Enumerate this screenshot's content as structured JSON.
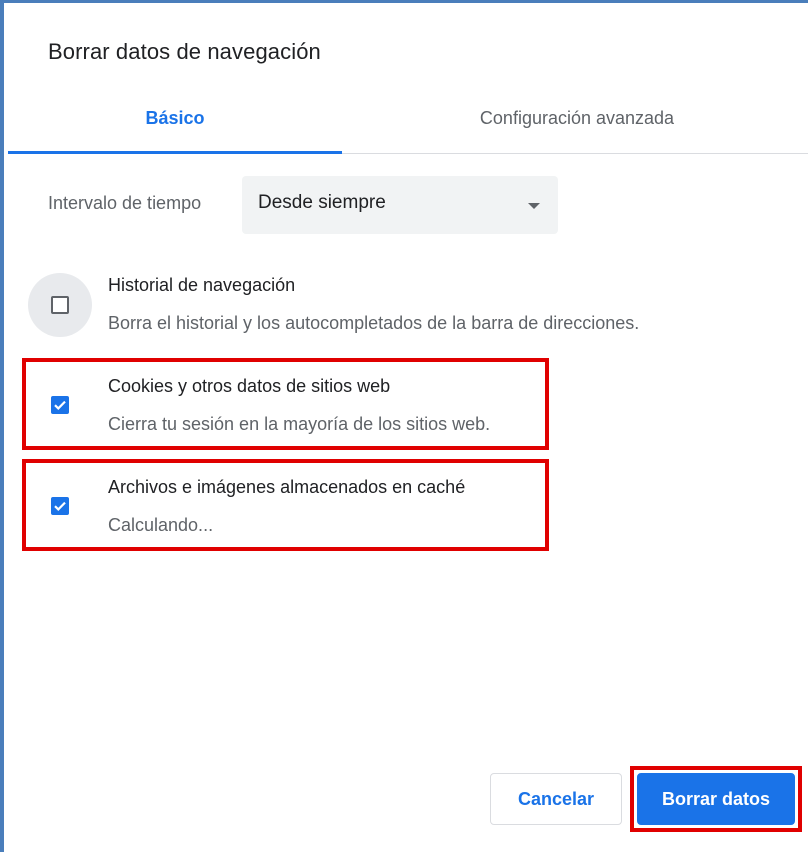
{
  "dialog": {
    "title": "Borrar datos de navegación"
  },
  "tabs": [
    {
      "label": "Básico",
      "active": true
    },
    {
      "label": "Configuración avanzada",
      "active": false
    }
  ],
  "time_range": {
    "label": "Intervalo de tiempo",
    "value": "Desde siempre"
  },
  "items": [
    {
      "label": "Historial de navegación",
      "description": "Borra el historial y los autocompletados de la barra de direcciones.",
      "checked": false
    },
    {
      "label": "Cookies y otros datos de sitios web",
      "description": "Cierra tu sesión en la mayoría de los sitios web.",
      "checked": true
    },
    {
      "label": "Archivos e imágenes almacenados en caché",
      "description": "Calculando...",
      "checked": true
    }
  ],
  "buttons": {
    "cancel": "Cancelar",
    "clear": "Borrar datos"
  },
  "colors": {
    "accent": "#1a73e8",
    "highlight": "#e00000",
    "frame": "#4a7ebb"
  },
  "icons": {
    "dropdown": "caret-down-icon",
    "check": "checkmark-icon"
  }
}
